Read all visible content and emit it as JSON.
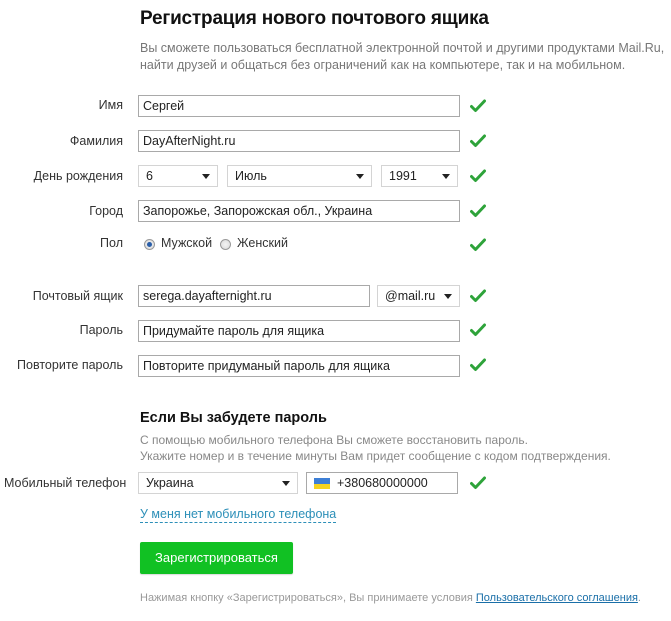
{
  "header": {
    "title": "Регистрация нового почтового ящика",
    "subtitle_line1": "Вы сможете пользоваться бесплатной электронной почтой и другими продуктами Mail.Ru,",
    "subtitle_line2": "найти друзей и общаться без ограничений как на компьютере, так и на мобильном."
  },
  "form": {
    "first_name": {
      "label": "Имя",
      "value": "Сергей",
      "valid": true
    },
    "last_name": {
      "label": "Фамилия",
      "value": "DayAfterNight.ru",
      "valid": true
    },
    "birthday": {
      "label": "День рождения",
      "day": "6",
      "month": "Июль",
      "year": "1991",
      "valid": true
    },
    "city": {
      "label": "Город",
      "value": "Запорожье, Запорожская обл., Украина",
      "valid": true
    },
    "gender": {
      "label": "Пол",
      "options": [
        {
          "label": "Мужской",
          "selected": true
        },
        {
          "label": "Женский",
          "selected": false
        }
      ],
      "valid": true
    },
    "mailbox": {
      "label": "Почтовый ящик",
      "value": "serega.dayafternight.ru",
      "domain": "@mail.ru",
      "valid": true
    },
    "password": {
      "label": "Пароль",
      "value": "Придумайте пароль для ящика",
      "valid": true
    },
    "password_repeat": {
      "label": "Повторите пароль",
      "value": "Повторите придуманый пароль для ящика",
      "valid": true
    }
  },
  "recovery": {
    "heading": "Если Вы забудете пароль",
    "help_line1": "С помощью мобильного телефона Вы сможете восстановить пароль.",
    "help_line2": "Укажите номер и в течение минуты Вам придет сообщение с кодом подтверждения.",
    "phone": {
      "label": "Мобильный телефон",
      "country": "Украина",
      "flag_icon": "ukraine-flag-icon",
      "value": "+380680000000",
      "valid": true
    },
    "no_phone_link": "У меня нет мобильного телефона"
  },
  "submit": {
    "label": "Зарегистрироваться",
    "color": "#11c123"
  },
  "terms": {
    "text": "Нажимая кнопку «Зарегистрироваться», Вы принимаете условия ",
    "link": "Пользовательского соглашения",
    "end": "."
  },
  "colors": {
    "check": "#2ea33a",
    "link": "#2c8fb8"
  }
}
